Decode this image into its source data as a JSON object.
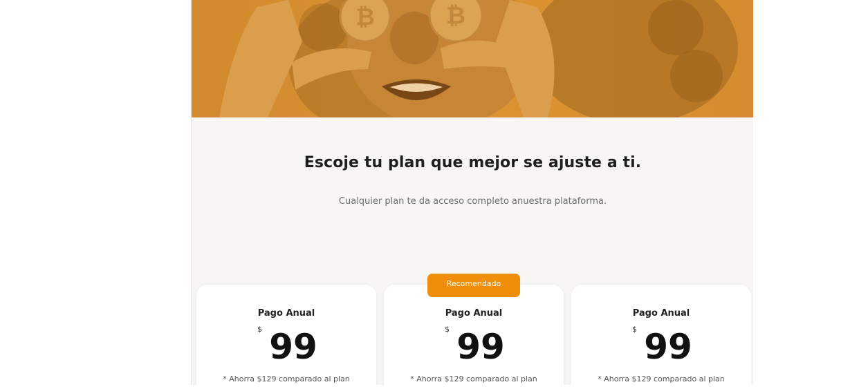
{
  "hero": {
    "image": "woman-holding-bitcoin-coins-over-eyes"
  },
  "section": {
    "title": "Escoje tu plan que mejor se ajuste a ti.",
    "subtitle": "Cualquier plan te da acceso completo anuestra plataforma."
  },
  "badge": {
    "label": "Recomendado"
  },
  "plans": [
    {
      "title": "Pago Anual",
      "currency": "$",
      "price": "99",
      "note": "* Ahorra $129 comparado al plan"
    },
    {
      "title": "Pago Anual",
      "currency": "$",
      "price": "99",
      "note": "* Ahorra $129 comparado al plan"
    },
    {
      "title": "Pago Anual",
      "currency": "$",
      "price": "99",
      "note": "* Ahorra $129 comparado al plan"
    }
  ],
  "colors": {
    "accent": "#ee8e0a",
    "hero_tint": "#d99435",
    "background": "#f7f6f4"
  }
}
